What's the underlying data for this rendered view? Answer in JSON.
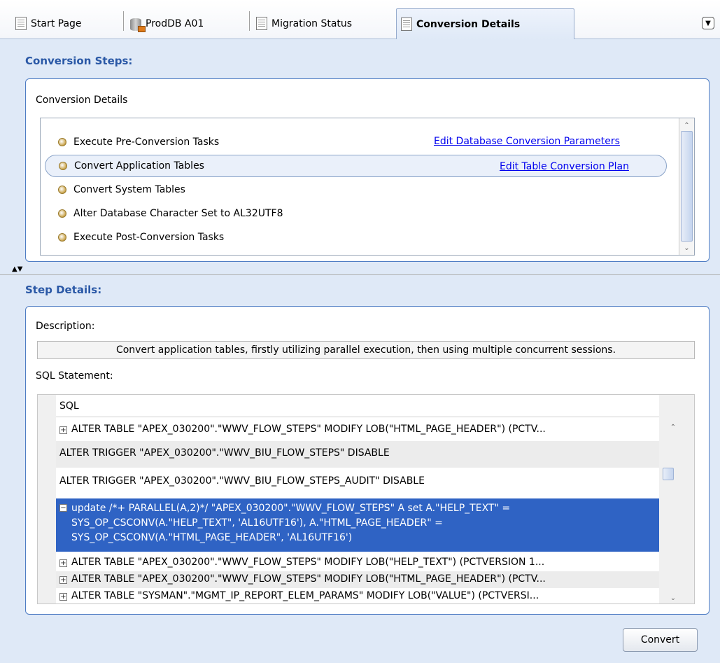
{
  "tabs": [
    {
      "label": "Start Page",
      "icon": "document-icon"
    },
    {
      "label": "ProdDB A01",
      "icon": "database-icon"
    },
    {
      "label": "Migration Status",
      "icon": "document-icon"
    },
    {
      "label": "Conversion Details",
      "icon": "document-icon",
      "active": true
    }
  ],
  "conversion_steps": {
    "title": "Conversion Steps:",
    "panel_label": "Conversion Details",
    "steps": [
      {
        "label": "Execute Pre-Conversion Tasks",
        "link": "Edit Database Conversion Parameters"
      },
      {
        "label": "Convert Application Tables",
        "link": "Edit Table Conversion Plan",
        "selected": true
      },
      {
        "label": "Convert System Tables"
      },
      {
        "label": "Alter Database Character Set to AL32UTF8"
      },
      {
        "label": "Execute Post-Conversion Tasks"
      }
    ]
  },
  "step_details": {
    "title": "Step Details:",
    "description_label": "Description:",
    "description": "Convert application tables, firstly utilizing parallel execution, then using multiple concurrent sessions.",
    "sql_label": "SQL Statement:",
    "grid_header": "SQL",
    "rows": [
      {
        "expander": "+",
        "text": "ALTER TABLE \"APEX_030200\".\"WWV_FLOW_STEPS\" MODIFY LOB(\"HTML_PAGE_HEADER\") (PCTV..."
      },
      {
        "expander": "",
        "text": "ALTER TRIGGER \"APEX_030200\".\"WWV_BIU_FLOW_STEPS\" DISABLE"
      },
      {
        "expander": "",
        "text": "ALTER TRIGGER \"APEX_030200\".\"WWV_BIU_FLOW_STEPS_AUDIT\" DISABLE"
      },
      {
        "expander": "−",
        "text": "update  /*+ PARALLEL(A,2)*/ \"APEX_030200\".\"WWV_FLOW_STEPS\" A  set A.\"HELP_TEXT\" = SYS_OP_CSCONV(A.\"HELP_TEXT\", 'AL16UTF16'), A.\"HTML_PAGE_HEADER\" = SYS_OP_CSCONV(A.\"HTML_PAGE_HEADER\", 'AL16UTF16')",
        "selected": true
      },
      {
        "expander": "+",
        "text": "ALTER TABLE \"APEX_030200\".\"WWV_FLOW_STEPS\" MODIFY LOB(\"HELP_TEXT\") (PCTVERSION 1..."
      },
      {
        "expander": "+",
        "text": "ALTER TABLE \"APEX_030200\".\"WWV_FLOW_STEPS\" MODIFY LOB(\"HTML_PAGE_HEADER\") (PCTV..."
      },
      {
        "expander": "+",
        "text": "ALTER TABLE \"SYSMAN\".\"MGMT_IP_REPORT_ELEM_PARAMS\" MODIFY LOB(\"VALUE\") (PCTVERSI..."
      }
    ]
  },
  "convert_button": "Convert"
}
